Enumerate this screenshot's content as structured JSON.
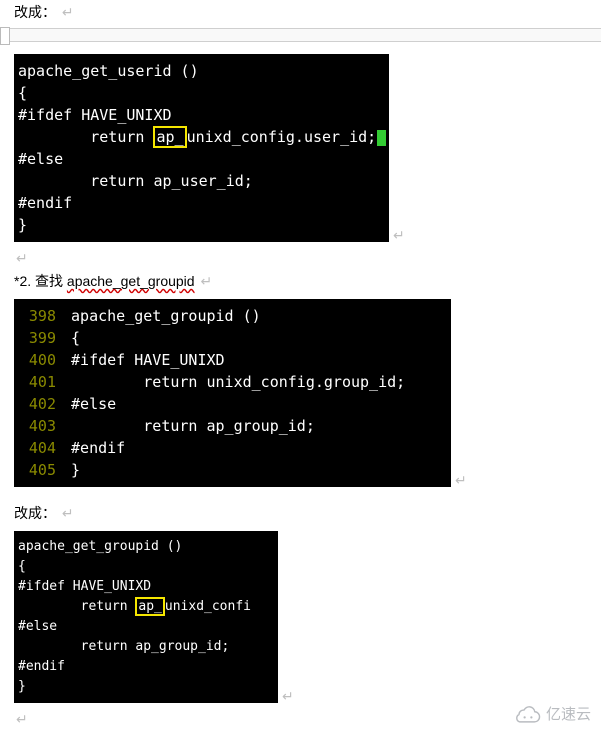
{
  "text": {
    "changeTo1": "改成：",
    "changeTo2": "改成：",
    "searchPrefix": "*2. 查找 ",
    "searchTerm": "apache_get_groupid",
    "pmark": "↵"
  },
  "codeblock1": {
    "l1": "apache_get_userid ()",
    "l2": "{",
    "l3": "#ifdef HAVE_UNIXD",
    "l4a": "        return ",
    "l4_hl": "ap_",
    "l4b": "unixd_config.user_id;",
    "l5": "#else",
    "l6": "        return ap_user_id;",
    "l7": "#endif",
    "l8": "}"
  },
  "codeblock2": {
    "r1": {
      "ln": "398",
      "c": "apache_get_groupid ()"
    },
    "r2": {
      "ln": "399",
      "c": "{"
    },
    "r3": {
      "ln": "400",
      "c": "#ifdef HAVE_UNIXD"
    },
    "r4": {
      "ln": "401",
      "c": "        return unixd_config.group_id;"
    },
    "r5": {
      "ln": "402",
      "c": "#else"
    },
    "r6": {
      "ln": "403",
      "c": "        return ap_group_id;"
    },
    "r7": {
      "ln": "404",
      "c": "#endif"
    },
    "r8": {
      "ln": "405",
      "c": "}"
    }
  },
  "codeblock3": {
    "l1": "apache_get_groupid ()",
    "l2": "{",
    "l3": "#ifdef HAVE_UNIXD",
    "l4a": "        return ",
    "l4_hl": "ap_",
    "l4b": "unixd_confi",
    "l5": "#else",
    "l6": "        return ap_group_id;",
    "l7": "#endif",
    "l8": "}"
  },
  "watermark": "亿速云"
}
